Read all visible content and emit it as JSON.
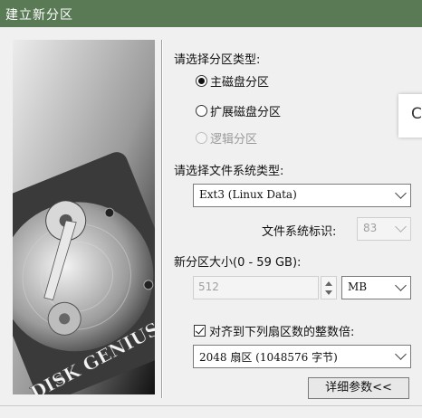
{
  "window": {
    "title": "建立新分区"
  },
  "image": {
    "brand": "DISK GENIUS"
  },
  "partition_type": {
    "heading": "请选择分区类型:",
    "options": [
      {
        "label": "主磁盘分区",
        "selected": true,
        "enabled": true
      },
      {
        "label": "扩展磁盘分区",
        "selected": false,
        "enabled": true
      },
      {
        "label": "逻辑分区",
        "selected": false,
        "enabled": false
      }
    ]
  },
  "filesystem": {
    "heading": "请选择文件系统类型:",
    "selected": "Ext3 (Linux Data)",
    "id_label": "文件系统标识:",
    "id_value": "83"
  },
  "size": {
    "heading": "新分区大小(0 - 59 GB):",
    "value": "512",
    "unit": "MB"
  },
  "align": {
    "checkbox_label": "对齐到下列扇区数的整数倍:",
    "checked": true,
    "selected": "2048 扇区 (1048576 字节)"
  },
  "buttons": {
    "details": "详细参数<<"
  },
  "overlay": {
    "glyph": "C"
  }
}
